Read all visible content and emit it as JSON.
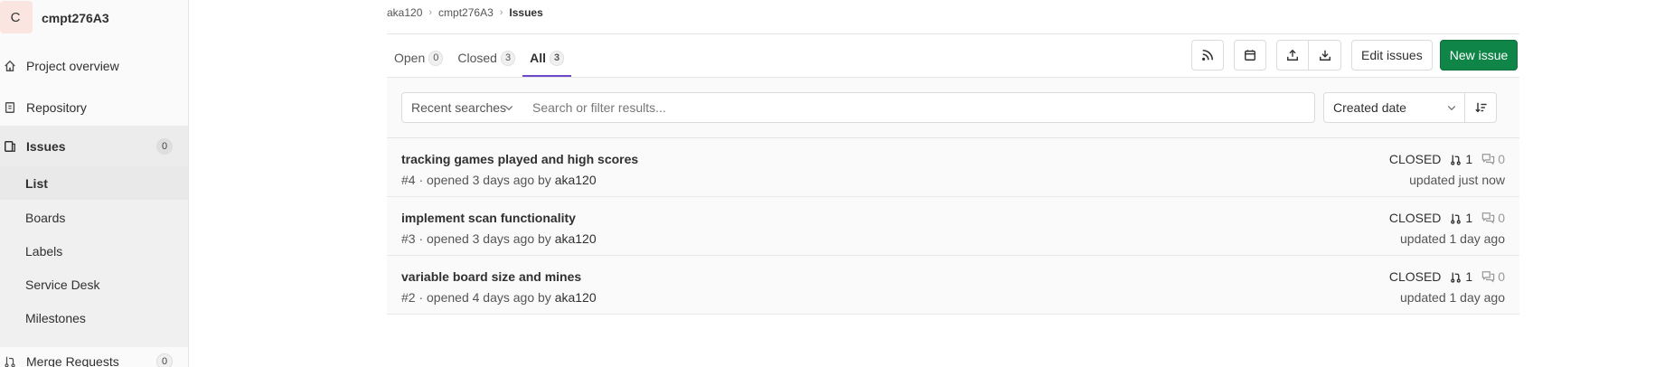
{
  "project": {
    "avatar_letter": "C",
    "name": "cmpt276A3",
    "avatar_color": "#fbe5e1"
  },
  "sidebar": {
    "items": [
      {
        "label": "Project overview",
        "icon": "home-icon"
      },
      {
        "label": "Repository",
        "icon": "doc-icon"
      },
      {
        "label": "Issues",
        "icon": "issues-icon",
        "count": "0"
      },
      {
        "label": "Merge Requests",
        "icon": "merge-request-icon",
        "count": "0"
      }
    ],
    "sub_items": [
      "List",
      "Boards",
      "Labels",
      "Service Desk",
      "Milestones"
    ]
  },
  "breadcrumb": [
    "aka120",
    "cmpt276A3",
    "Issues"
  ],
  "tabs": [
    {
      "label": "Open",
      "count": "0"
    },
    {
      "label": "Closed",
      "count": "3"
    },
    {
      "label": "All",
      "count": "3"
    }
  ],
  "toolbar": {
    "edit_label": "Edit issues",
    "new_label": "New issue",
    "primary_color": "#108548",
    "icons": [
      "rss-icon",
      "calendar-icon",
      "export-icon",
      "import-icon"
    ]
  },
  "filter": {
    "recent_label": "Recent searches",
    "search_placeholder": "Search or filter results...",
    "sort_label": "Created date"
  },
  "issues": [
    {
      "title": "tracking games played and high scores",
      "meta": "#4 · opened 3 days ago by",
      "author": "aka120",
      "status": "CLOSED",
      "mrs": "1",
      "comments": "0",
      "updated": "updated just now"
    },
    {
      "title": "implement scan functionality",
      "meta": "#3 · opened 3 days ago by",
      "author": "aka120",
      "status": "CLOSED",
      "mrs": "1",
      "comments": "0",
      "updated": "updated 1 day ago"
    },
    {
      "title": "variable board size and mines",
      "meta": "#2 · opened 4 days ago by",
      "author": "aka120",
      "status": "CLOSED",
      "mrs": "1",
      "comments": "0",
      "updated": "updated 1 day ago"
    }
  ]
}
